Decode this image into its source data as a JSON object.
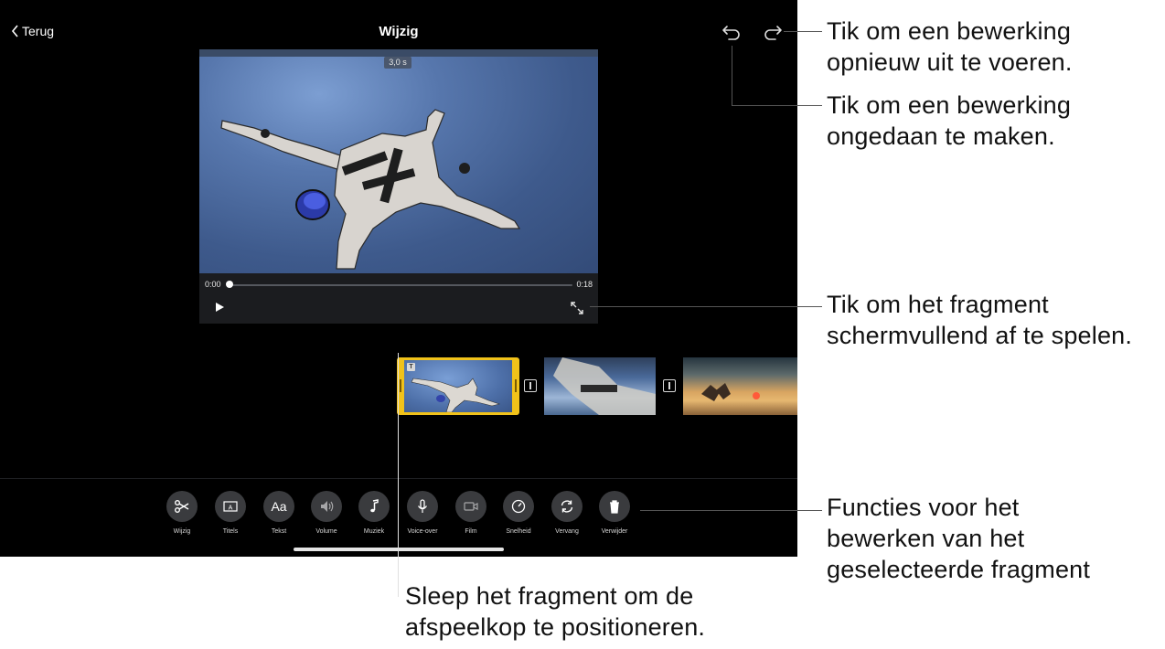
{
  "header": {
    "back_label": "Terug",
    "title": "Wijzig",
    "undo_icon": "undo-arrow-icon",
    "redo_icon": "redo-arrow-icon"
  },
  "viewer": {
    "duration_badge": "3,0 s",
    "time_start": "0:00",
    "time_end": "0:18",
    "playback_progress": 0.0
  },
  "toolbar": {
    "tools": [
      {
        "label": "Wijzig",
        "icon": "scissors-icon"
      },
      {
        "label": "Titels",
        "icon": "titles-icon"
      },
      {
        "label": "Tekst",
        "icon": "text-icon",
        "glyph": "Aa"
      },
      {
        "label": "Volume",
        "icon": "speaker-icon"
      },
      {
        "label": "Muziek",
        "icon": "music-note-icon"
      },
      {
        "label": "Voice-over",
        "icon": "microphone-icon"
      },
      {
        "label": "Film",
        "icon": "camera-icon"
      },
      {
        "label": "Snelheid",
        "icon": "speedometer-icon"
      },
      {
        "label": "Vervang",
        "icon": "replace-icon"
      },
      {
        "label": "Verwijder",
        "icon": "trash-icon"
      }
    ]
  },
  "callouts": {
    "redo": "Tik om een bewerking opnieuw uit te voeren.",
    "undo": "Tik om een bewerking ongedaan te maken.",
    "fullscreen": "Tik om het fragment schermvullend af te spelen.",
    "functions": "Functies voor het bewerken van het geselecteerde fragment",
    "playhead": "Sleep het fragment om de afspeelkop te positioneren."
  },
  "colors": {
    "selection": "#f1c21a",
    "background": "#000000",
    "tool_circle": "#3a3b3e"
  }
}
